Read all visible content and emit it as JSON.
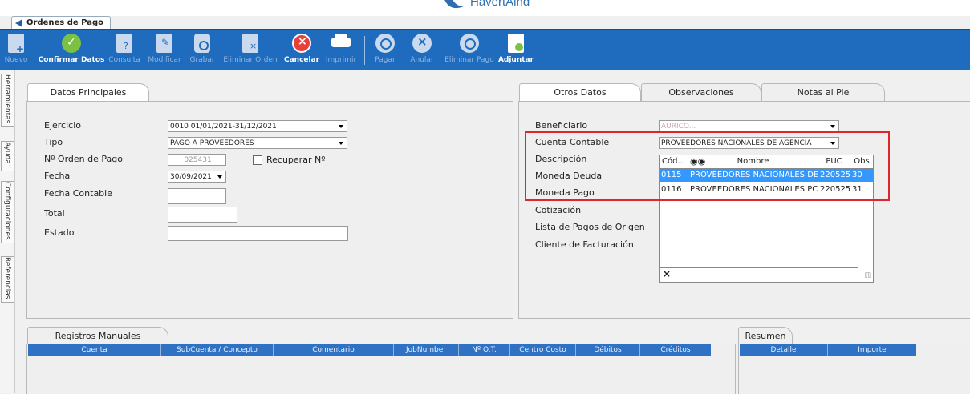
{
  "branding": {
    "logo_text": "HavertAind"
  },
  "window_tab": {
    "label": "Ordenes de Pago"
  },
  "toolbar": [
    {
      "label": "Nuevo",
      "enabled": false,
      "icon": "new-doc-icon"
    },
    {
      "label": "Confirmar Datos",
      "enabled": true,
      "icon": "check-circle-icon"
    },
    {
      "label": "Consulta",
      "enabled": false,
      "icon": "query-doc-icon"
    },
    {
      "label": "Modificar",
      "enabled": false,
      "icon": "edit-doc-icon"
    },
    {
      "label": "Grabar",
      "enabled": false,
      "icon": "save-icon"
    },
    {
      "label": "Eliminar Orden",
      "enabled": false,
      "icon": "delete-doc-icon"
    },
    {
      "label": "Cancelar",
      "enabled": true,
      "icon": "cancel-icon"
    },
    {
      "label": "Imprimir",
      "enabled": false,
      "icon": "printer-icon"
    },
    {
      "label": "Pagar",
      "enabled": false,
      "icon": "pay-icon"
    },
    {
      "label": "Anular",
      "enabled": false,
      "icon": "void-icon"
    },
    {
      "label": "Eliminar Pago",
      "enabled": false,
      "icon": "delete-payment-icon"
    },
    {
      "label": "Adjuntar",
      "enabled": true,
      "icon": "attach-doc-icon"
    }
  ],
  "side_tabs": [
    "Herramientas",
    "Ayuda",
    "Configuraciones",
    "Referencias"
  ],
  "main_panel": {
    "tab": "Datos Principales",
    "fields": {
      "ejercicio": {
        "label": "Ejercicio",
        "value": "0010 01/01/2021-31/12/2021"
      },
      "tipo": {
        "label": "Tipo",
        "value": "PAGO A PROVEEDORES"
      },
      "nro_orden": {
        "label": "Nº Orden de Pago",
        "value": "025431"
      },
      "recuperar": {
        "label": "Recuperar Nº",
        "checked": false
      },
      "fecha": {
        "label": "Fecha",
        "value": "30/09/2021"
      },
      "fecha_contable": {
        "label": "Fecha Contable",
        "value": ""
      },
      "total": {
        "label": "Total",
        "value": ""
      },
      "estado": {
        "label": "Estado",
        "value": ""
      }
    }
  },
  "other_panel": {
    "tabs": [
      "Otros Datos",
      "Observaciones",
      "Notas al Pie"
    ],
    "labels": {
      "beneficiario": "Beneficiario",
      "cuenta_contable": "Cuenta Contable",
      "descripcion": "Descripción",
      "moneda_deuda": "Moneda Deuda",
      "moneda_pago": "Moneda Pago",
      "cotizacion": "Cotización",
      "lista_pagos": "Lista de Pagos de Origen",
      "cliente_facturacion": "Cliente de Facturación"
    },
    "beneficiario_value": "AURICO...",
    "cuenta_contable_value": "PROVEEDORES NACIONALES DE AGENCIA",
    "dropdown": {
      "headers": {
        "cod": "Cód...",
        "nombre": "Nombre",
        "puc": "PUC",
        "obs": "Obs"
      },
      "rows": [
        {
          "cod": "0115",
          "nombre": "PROVEEDORES NACIONALES DE",
          "puc": "220525",
          "obs": "30",
          "selected": true
        },
        {
          "cod": "0116",
          "nombre": "PROVEEDORES NACIONALES PC",
          "puc": "220525",
          "obs": "31",
          "selected": false
        }
      ],
      "close_label": "×"
    }
  },
  "registros": {
    "tab": "Registros Manuales",
    "columns": [
      "Cuenta",
      "SubCuenta / Concepto",
      "Comentario",
      "JobNumber",
      "Nº O.T.",
      "Centro Costo",
      "Débitos",
      "Créditos"
    ]
  },
  "resumen": {
    "tab": "Resumen",
    "columns": [
      "Detalle",
      "Importe"
    ]
  },
  "colors": {
    "toolbar": "#1f6bbd",
    "grid_header": "#2f72c4",
    "highlight": "#e0262a",
    "selection": "#3399ff"
  }
}
